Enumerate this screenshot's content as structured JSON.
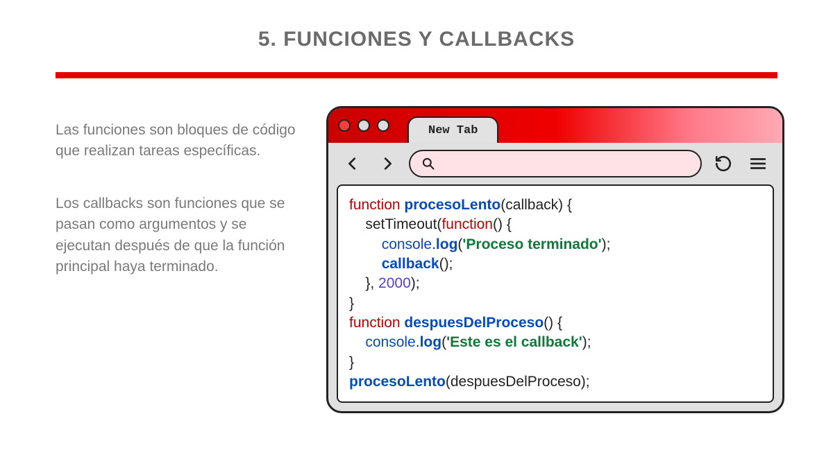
{
  "title": "5. FUNCIONES Y CALLBACKS",
  "paragraphs": {
    "p1": "Las funciones son bloques de código que realizan tareas específicas.",
    "p2": "Los callbacks son funciones que se pasan como argumentos y se ejecutan después de que la función principal haya terminado."
  },
  "browser": {
    "tab_label": "New Tab"
  },
  "code": {
    "kw_function_1": "function",
    "name_procesoLento": "procesoLento",
    "open_paren_cb": "(callback) {",
    "line2_pre": "    setTimeout(",
    "kw_function_2": "function",
    "line2_post": "() {",
    "line3_pre": "        ",
    "console_1": "console",
    "dot_1": ".",
    "log_1": "log",
    "line3_open": "(",
    "str_1": "'Proceso terminado'",
    "line3_close": ");",
    "line4_pre": "        ",
    "callback_call": "callback",
    "line4_post": "();",
    "line5": "    }, ",
    "num_2000": "2000",
    "line5_post": ");",
    "line6": "}",
    "kw_function_3": "function",
    "name_despuesDelProceso": "despuesDelProceso",
    "line7_post": "() {",
    "line8_pre": "    ",
    "console_2": "console",
    "dot_2": ".",
    "log_2": "log",
    "line8_open": "(",
    "str_2": "'Este es el callback'",
    "line8_close": ");",
    "line9": "}",
    "call_procesoLento": "procesoLento",
    "line10_post": "(despuesDelProceso);"
  }
}
